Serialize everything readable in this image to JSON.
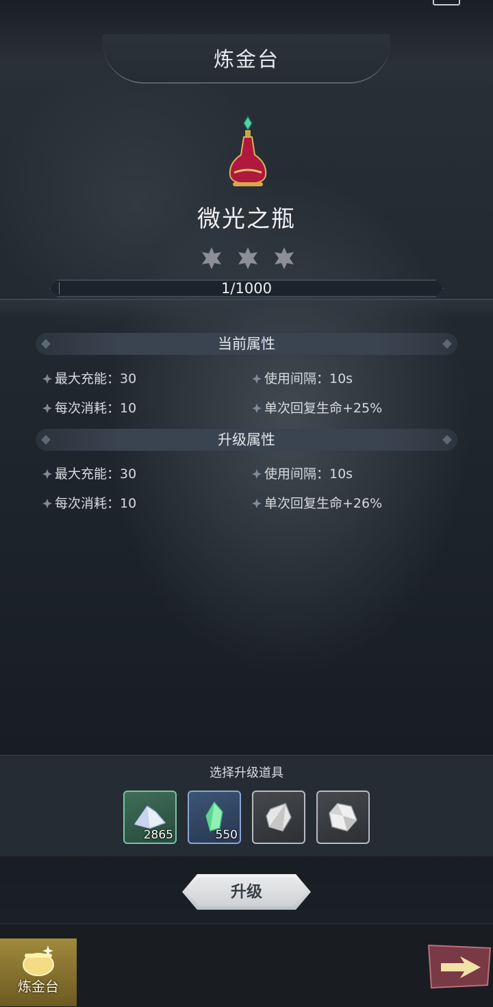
{
  "header": {
    "title": "炼金台"
  },
  "item": {
    "name": "微光之瓶",
    "icon": "potion-icon",
    "stars_total": 3,
    "stars_filled": 0,
    "progress_text": "1/1000",
    "progress_fraction": 0.001
  },
  "current": {
    "header": "当前属性",
    "attrs": [
      "最大充能：30",
      "使用间隔：10s",
      "每次消耗：10",
      "单次回复生命+25%"
    ]
  },
  "upgrade_attrs": {
    "header": "升级属性",
    "attrs": [
      "最大充能：30",
      "使用间隔：10s",
      "每次消耗：10",
      "单次回复生命+26%"
    ]
  },
  "materials": {
    "caption": "选择升级道具",
    "slots": [
      {
        "icon": "crystal-powder-icon",
        "count": "2865",
        "rarity_color": "#7bc4a2"
      },
      {
        "icon": "green-crystal-icon",
        "count": "550",
        "rarity_color": "#8aa6d6"
      },
      {
        "icon": "gray-stone-icon",
        "count": "",
        "rarity_color": "#b8bcc1"
      },
      {
        "icon": "gray-gem-icon",
        "count": "",
        "rarity_color": "#b8bcc1"
      }
    ]
  },
  "actions": {
    "upgrade_label": "升级"
  },
  "nav": {
    "tab_label": "炼金台",
    "next_icon": "arrow-right-icon"
  }
}
